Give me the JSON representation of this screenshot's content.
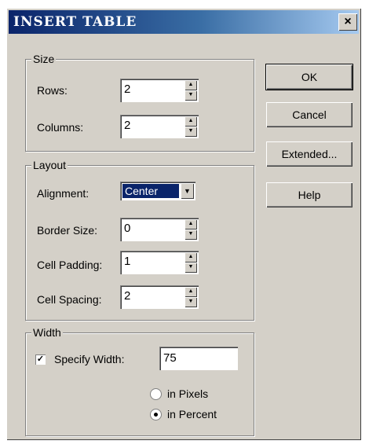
{
  "window": {
    "title": "INSERT TABLE",
    "close_glyph": "×"
  },
  "size_group": {
    "label": "Size",
    "rows_label": "Rows:",
    "rows_value": "2",
    "columns_label": "Columns:",
    "columns_value": "2"
  },
  "layout_group": {
    "label": "Layout",
    "alignment_label": "Alignment:",
    "alignment_value": "Center",
    "border_label": "Border Size:",
    "border_value": "0",
    "padding_label": "Cell Padding:",
    "padding_value": "1",
    "spacing_label": "Cell Spacing:",
    "spacing_value": "2"
  },
  "width_group": {
    "label": "Width",
    "specify_label": "Specify Width:",
    "specify_checked": true,
    "check_glyph": "✓",
    "width_value": "75",
    "pixels_label": "in Pixels",
    "percent_label": "in Percent",
    "selected_unit": "percent"
  },
  "buttons": {
    "ok": "OK",
    "cancel": "Cancel",
    "extended": "Extended...",
    "help": "Help"
  },
  "icons": {
    "spin_up": "▲",
    "spin_down": "▼",
    "dropdown": "▼"
  }
}
